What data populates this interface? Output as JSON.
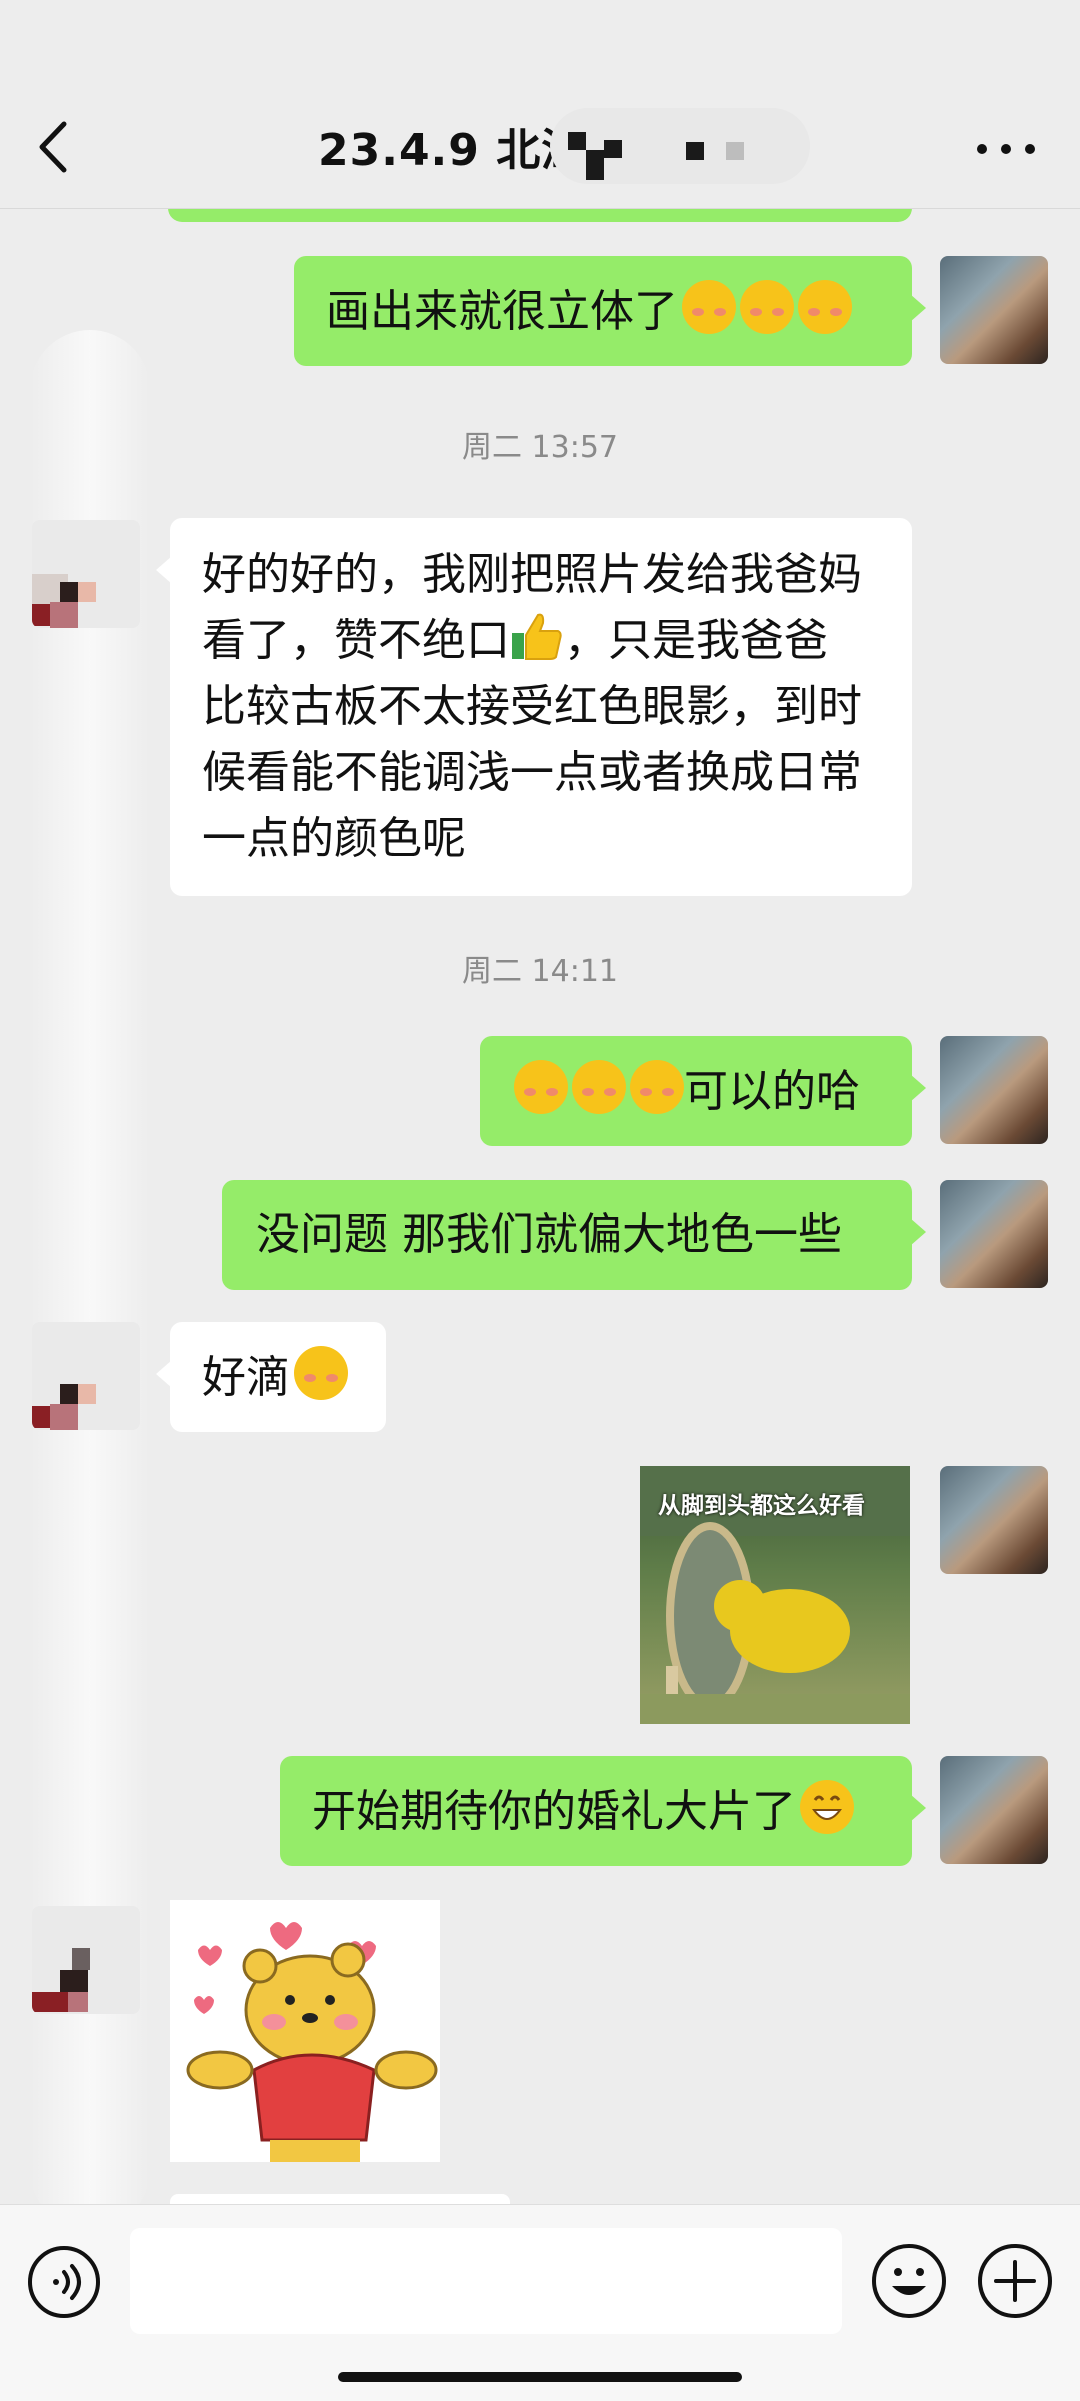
{
  "header": {
    "title": "23.4.9 北湖",
    "back_icon": "chevron-left-icon",
    "more_icon": "more-dots-icon"
  },
  "messages": [
    {
      "id": "m1",
      "direction": "out",
      "text": "画出来就很立体了",
      "emojis": [
        "blush-laugh",
        "blush-laugh",
        "blush-laugh"
      ]
    },
    {
      "id": "t1",
      "type": "timestamp",
      "text": "周二 13:57"
    },
    {
      "id": "m2",
      "direction": "in",
      "lines": [
        "好的好的，我刚把照片发给我爸妈",
        "看了，赞不绝口",
        "，只是我爸爸",
        "比较古板不太接受红色眼影，到时",
        "候看能不能调浅一点或者换成日常",
        "一点的颜色呢"
      ]
    },
    {
      "id": "t2",
      "type": "timestamp",
      "text": "周二 14:11"
    },
    {
      "id": "m3",
      "direction": "out",
      "text": "可以的哈",
      "emojis": [
        "smile",
        "smile",
        "smile"
      ]
    },
    {
      "id": "m4",
      "direction": "out",
      "text": "没问题 那我们就偏大地色一些"
    },
    {
      "id": "m5",
      "direction": "in",
      "text": "好滴"
    },
    {
      "id": "m6",
      "direction": "out",
      "type": "sticker",
      "caption": "从脚到头都这么好看"
    },
    {
      "id": "m7",
      "direction": "out",
      "text": "开始期待你的婚礼大片了"
    },
    {
      "id": "m8",
      "direction": "in",
      "type": "sticker"
    }
  ],
  "bottom": {
    "voice_icon": "voice-icon",
    "emoji_icon": "emoji-icon",
    "plus_icon": "plus-icon",
    "input_value": ""
  },
  "colors": {
    "out_bubble": "#95ec69",
    "in_bubble": "#ffffff",
    "background": "#ededed"
  }
}
